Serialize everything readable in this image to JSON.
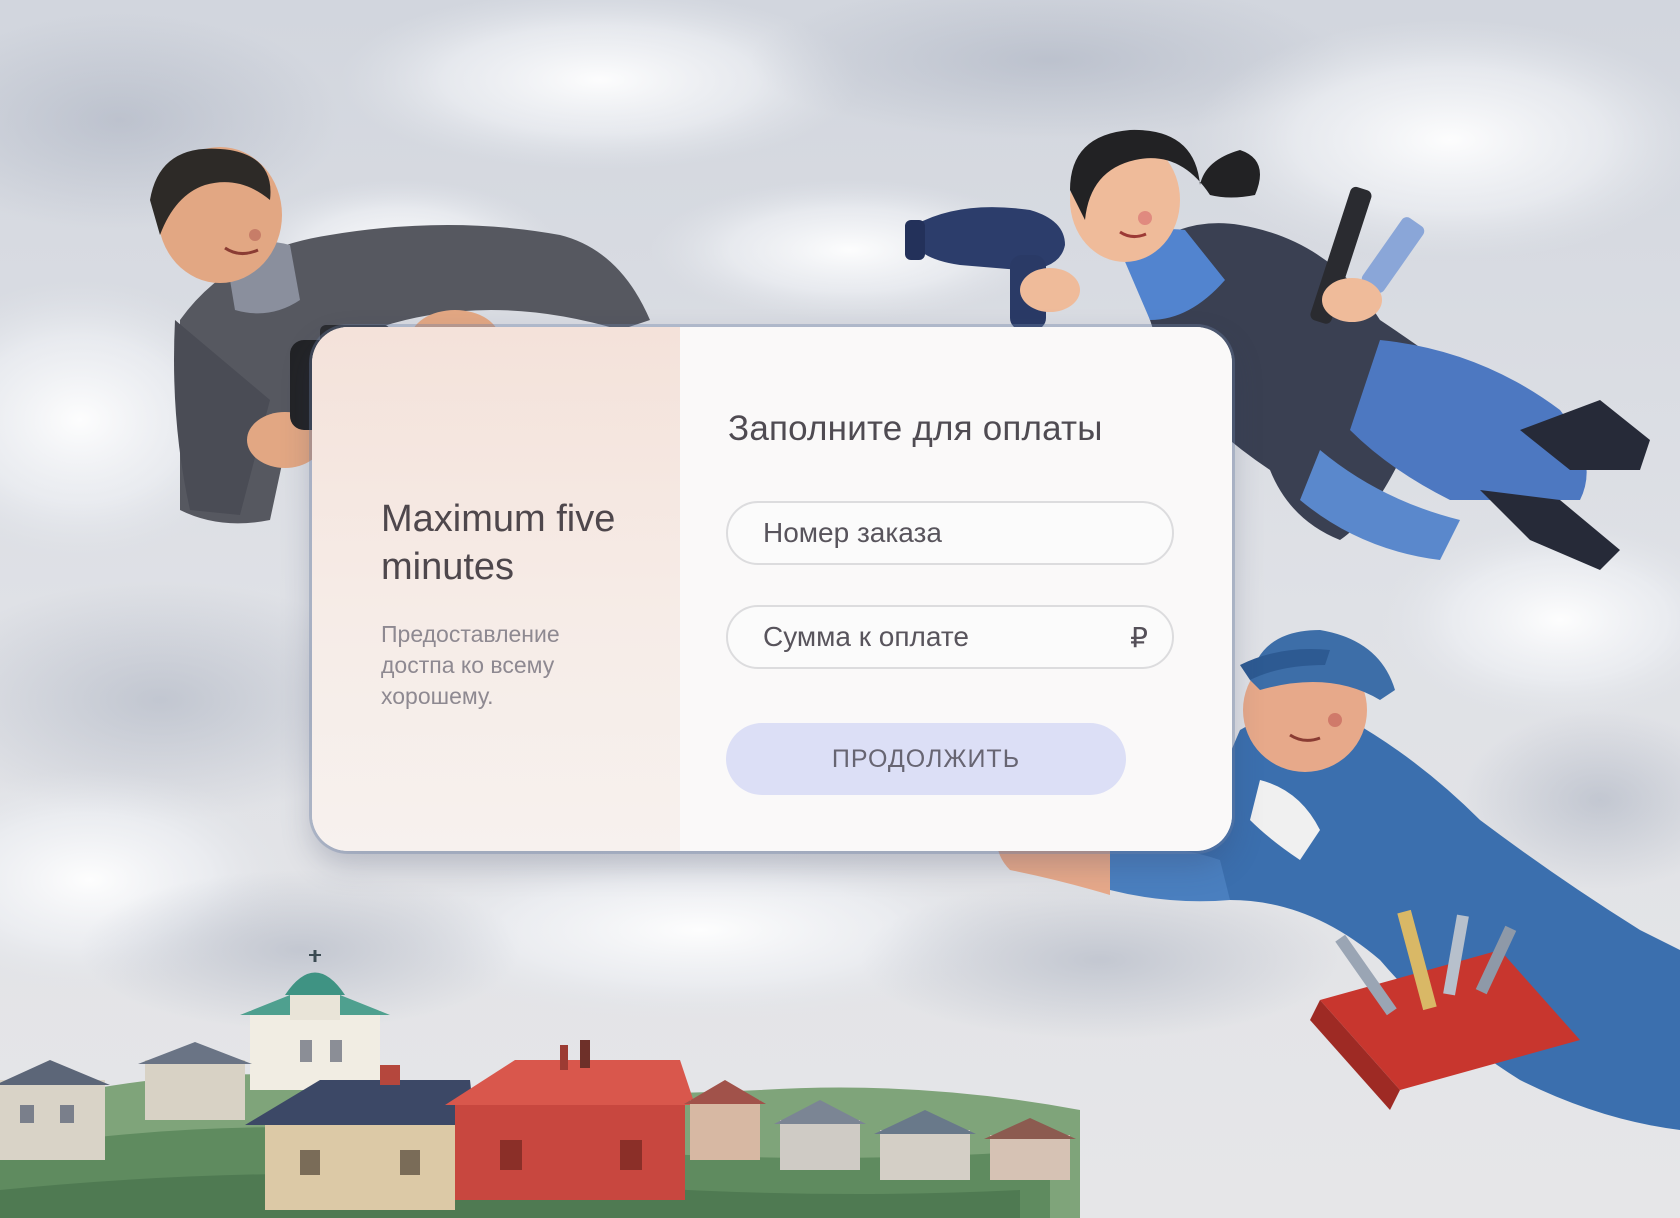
{
  "brand": {
    "title": "Maximum five minutes",
    "subtitle": "Предоставление достпа ко всему хорошему."
  },
  "form": {
    "title": "Заполните для оплаты",
    "order_number": {
      "value": "",
      "placeholder": "Номер заказа"
    },
    "amount": {
      "value": "",
      "placeholder": "Сумма к оплате",
      "currency_symbol": "₽"
    },
    "submit_label": "ПРОДОЛЖИТЬ"
  },
  "colors": {
    "sky": "#d8dbe2",
    "card_left": "#f4e2da",
    "card_right": "#faf9f9",
    "button": "#dcdff6",
    "text_dark": "#4e474c",
    "text_muted": "#8e8991"
  },
  "illustration": {
    "figures": [
      "photographer-with-camera",
      "hairdresser-with-dryer-and-combs",
      "repairman-with-toolbox"
    ],
    "scenery": [
      "cloudy-sky",
      "village-houses",
      "church-with-green-dome",
      "green-hills"
    ]
  }
}
